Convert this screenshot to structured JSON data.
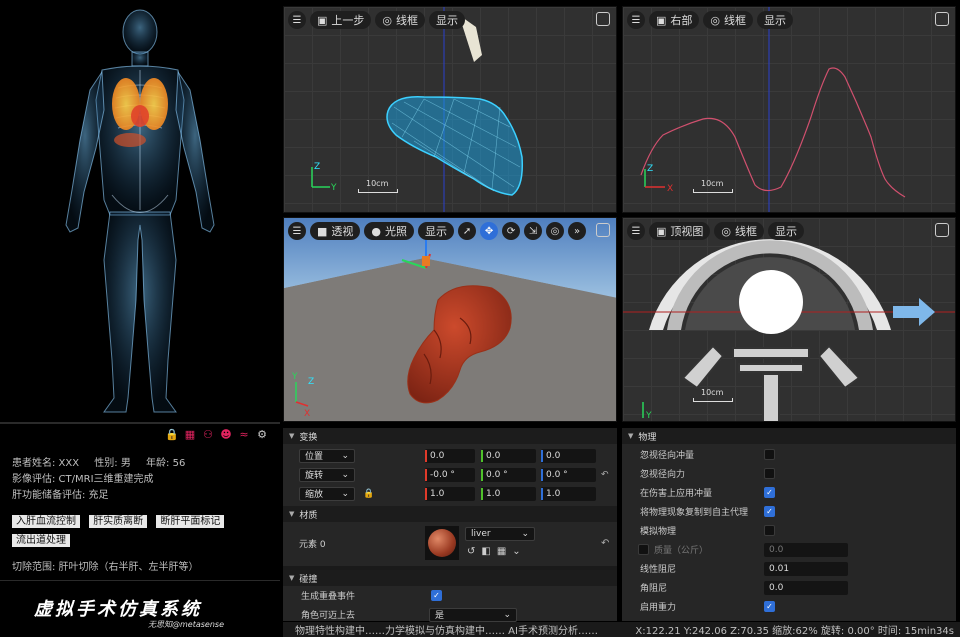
{
  "patient": {
    "name_label": "患者姓名: XXX",
    "gender_label": "性别: 男",
    "age_label": "年龄: 56",
    "imaging": "影像评估: CT/MRI三维重建完成",
    "liver_function": "肝功能储备评估: 充足",
    "cut_range": "切除范围: 肝叶切除（右半肝、左半肝等）"
  },
  "left_buttons": [
    "入肝血流控制",
    "肝实质离断",
    "断肝平面标记",
    "流出道处理"
  ],
  "left_icons": [
    "lock-icon",
    "hospital-icon",
    "surgeon-icon",
    "user-icon",
    "wifi-icon",
    "gear-icon"
  ],
  "brand": {
    "title": "虚拟手术仿真系统",
    "subtitle": "无思知@metasense"
  },
  "viewports": {
    "top_left": {
      "view": "上一步",
      "mode": "线框",
      "display": "显示",
      "scale": "10cm"
    },
    "top_right": {
      "view": "右部",
      "mode": "线框",
      "display": "显示",
      "scale": "10cm"
    },
    "bottom_left": {
      "view": "透视",
      "mode": "光照",
      "display": "显示"
    },
    "bottom_right": {
      "view": "顶视图",
      "mode": "线框",
      "display": "显示",
      "scale": "10cm"
    }
  },
  "transform": {
    "section": "变换",
    "position": {
      "label": "位置",
      "x": "0.0",
      "y": "0.0",
      "z": "0.0"
    },
    "rotation": {
      "label": "旋转",
      "x": "-0.0 °",
      "y": "0.0 °",
      "z": "0.0 °"
    },
    "scale": {
      "label": "缩放",
      "x": "1.0",
      "y": "1.0",
      "z": "1.0"
    }
  },
  "material": {
    "section": "材质",
    "element_label": "元素 0",
    "material_name": "liver"
  },
  "collision": {
    "section": "碰撞",
    "generate_overlap": "生成重叠事件",
    "can_step_up": "角色可迈上去",
    "can_step_up_value": "是"
  },
  "physics": {
    "section": "物理",
    "ignore_radial_impulse": "忽视径向冲量",
    "ignore_radial_force": "忽视径向力",
    "apply_impulse_on_damage": "在伤害上应用冲量",
    "replicate_physics": "将物理现象复制到自主代理",
    "simulate_physics": "模拟物理",
    "mass_label": "质量（公斤）",
    "mass_value": "0.0",
    "linear_damping_label": "线性阻尼",
    "linear_damping_value": "0.01",
    "angular_damping_label": "角阻尼",
    "angular_damping_value": "0.0",
    "enable_gravity": "启用重力"
  },
  "status": {
    "left": "物理特性构建中……力学模拟与仿真构建中……  AI手术预测分析……",
    "right": "X:122.21 Y:242.06 Z:70.35 缩放:62% 旋转: 0.00° 时间: 15min34s"
  },
  "colors": {
    "wire_blue": "#2fb8f0",
    "mesh_red": "#b03a22",
    "curve_pink": "#d0506e",
    "accent_blue": "#2f6fd8",
    "icon_pink": "#e2235f"
  }
}
